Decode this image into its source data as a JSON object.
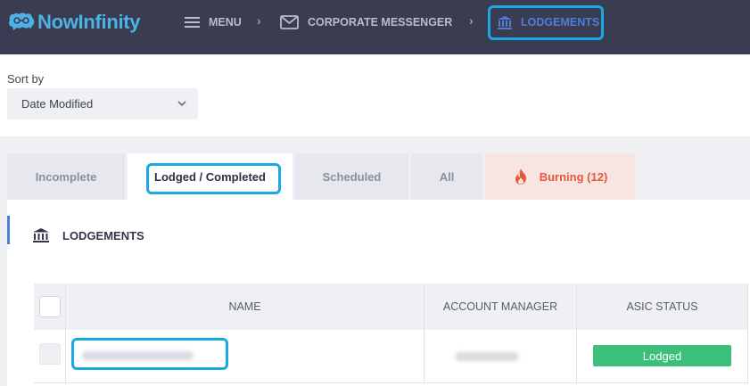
{
  "brand": {
    "name": "NowInfinity"
  },
  "nav": {
    "menu_label": "MENU",
    "crumb1_label": "CORPORATE MESSENGER",
    "crumb2_label": "LODGEMENTS",
    "separator": "›"
  },
  "sort": {
    "label": "Sort by",
    "value": "Date Modified"
  },
  "tabs": [
    {
      "label": "Incomplete"
    },
    {
      "label": "Lodged / Completed"
    },
    {
      "label": "Scheduled"
    },
    {
      "label": "All"
    },
    {
      "label": "Burning (12)"
    }
  ],
  "section": {
    "title": "LODGEMENTS"
  },
  "table": {
    "columns": [
      "NAME",
      "ACCOUNT MANAGER",
      "ASIC STATUS"
    ],
    "rows": [
      {
        "status": "Lodged"
      }
    ]
  },
  "colors": {
    "accent": "#4d7fd8",
    "highlight": "#19a9e3",
    "burning": "#e8573b",
    "status_lodged": "#3bbf7a"
  }
}
